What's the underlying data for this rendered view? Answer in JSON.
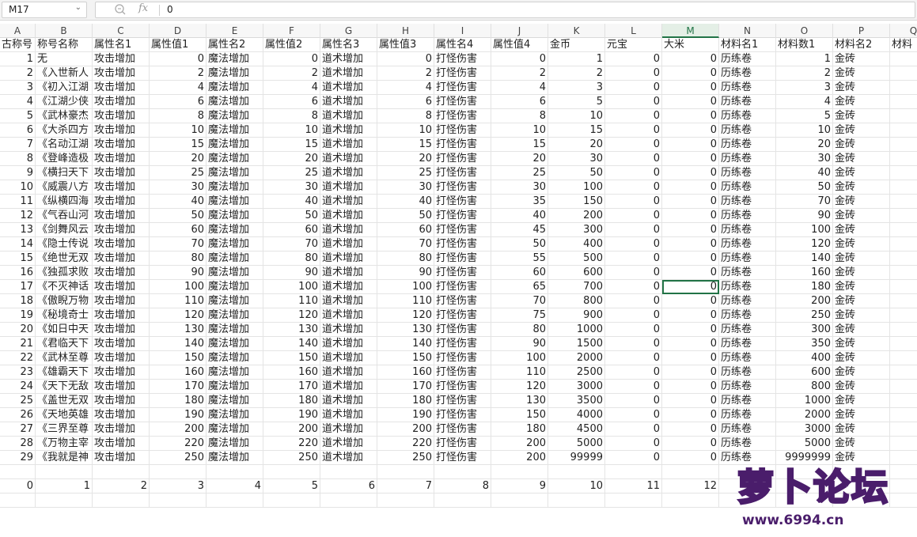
{
  "formula_bar": {
    "cell_ref": "M17",
    "fx_label": "fx",
    "formula": "0"
  },
  "columns": [
    "A",
    "B",
    "C",
    "D",
    "E",
    "F",
    "G",
    "H",
    "I",
    "J",
    "K",
    "L",
    "M",
    "N",
    "O",
    "P",
    "Q"
  ],
  "active_column": "M",
  "selected_cell": {
    "row": 16,
    "col": 12
  },
  "headers": [
    "古称号",
    "称号名称",
    "属性名1",
    "属性值1",
    "属性名2",
    "属性值2",
    "属性名3",
    "属性值3",
    "属性名4",
    "属性值4",
    "金币",
    "元宝",
    "大米",
    "材料名1",
    "材料数1",
    "材料名2",
    "材料"
  ],
  "rows": [
    [
      "1",
      "无",
      "攻击增加",
      "0",
      "魔法增加",
      "0",
      "道术增加",
      "0",
      "打怪伤害",
      "0",
      "1",
      "0",
      "0",
      "历练卷",
      "1",
      "金砖",
      ""
    ],
    [
      "2",
      "《入世新人",
      "攻击增加",
      "2",
      "魔法增加",
      "2",
      "道术增加",
      "2",
      "打怪伤害",
      "2",
      "2",
      "0",
      "0",
      "历练卷",
      "2",
      "金砖",
      ""
    ],
    [
      "3",
      "《初入江湖",
      "攻击增加",
      "4",
      "魔法增加",
      "4",
      "道术增加",
      "4",
      "打怪伤害",
      "4",
      "3",
      "0",
      "0",
      "历练卷",
      "3",
      "金砖",
      ""
    ],
    [
      "4",
      "《江湖少侠",
      "攻击增加",
      "6",
      "魔法增加",
      "6",
      "道术增加",
      "6",
      "打怪伤害",
      "6",
      "5",
      "0",
      "0",
      "历练卷",
      "4",
      "金砖",
      ""
    ],
    [
      "5",
      "《武林豪杰",
      "攻击增加",
      "8",
      "魔法增加",
      "8",
      "道术增加",
      "8",
      "打怪伤害",
      "8",
      "10",
      "0",
      "0",
      "历练卷",
      "5",
      "金砖",
      ""
    ],
    [
      "6",
      "《大杀四方",
      "攻击增加",
      "10",
      "魔法增加",
      "10",
      "道术增加",
      "10",
      "打怪伤害",
      "10",
      "15",
      "0",
      "0",
      "历练卷",
      "10",
      "金砖",
      ""
    ],
    [
      "7",
      "《名动江湖",
      "攻击增加",
      "15",
      "魔法增加",
      "15",
      "道术增加",
      "15",
      "打怪伤害",
      "15",
      "20",
      "0",
      "0",
      "历练卷",
      "20",
      "金砖",
      ""
    ],
    [
      "8",
      "《登峰造极",
      "攻击增加",
      "20",
      "魔法增加",
      "20",
      "道术增加",
      "20",
      "打怪伤害",
      "20",
      "30",
      "0",
      "0",
      "历练卷",
      "30",
      "金砖",
      ""
    ],
    [
      "9",
      "《横扫天下",
      "攻击增加",
      "25",
      "魔法增加",
      "25",
      "道术增加",
      "25",
      "打怪伤害",
      "25",
      "50",
      "0",
      "0",
      "历练卷",
      "40",
      "金砖",
      ""
    ],
    [
      "10",
      "《威震八方",
      "攻击增加",
      "30",
      "魔法增加",
      "30",
      "道术增加",
      "30",
      "打怪伤害",
      "30",
      "100",
      "0",
      "0",
      "历练卷",
      "50",
      "金砖",
      ""
    ],
    [
      "11",
      "《纵横四海",
      "攻击增加",
      "40",
      "魔法增加",
      "40",
      "道术增加",
      "40",
      "打怪伤害",
      "35",
      "150",
      "0",
      "0",
      "历练卷",
      "70",
      "金砖",
      ""
    ],
    [
      "12",
      "《气吞山河",
      "攻击增加",
      "50",
      "魔法增加",
      "50",
      "道术增加",
      "50",
      "打怪伤害",
      "40",
      "200",
      "0",
      "0",
      "历练卷",
      "90",
      "金砖",
      ""
    ],
    [
      "13",
      "《剑舞风云",
      "攻击增加",
      "60",
      "魔法增加",
      "60",
      "道术增加",
      "60",
      "打怪伤害",
      "45",
      "300",
      "0",
      "0",
      "历练卷",
      "100",
      "金砖",
      ""
    ],
    [
      "14",
      "《隐士传说",
      "攻击增加",
      "70",
      "魔法增加",
      "70",
      "道术增加",
      "70",
      "打怪伤害",
      "50",
      "400",
      "0",
      "0",
      "历练卷",
      "120",
      "金砖",
      ""
    ],
    [
      "15",
      "《绝世无双",
      "攻击增加",
      "80",
      "魔法增加",
      "80",
      "道术增加",
      "80",
      "打怪伤害",
      "55",
      "500",
      "0",
      "0",
      "历练卷",
      "140",
      "金砖",
      ""
    ],
    [
      "16",
      "《独孤求败",
      "攻击增加",
      "90",
      "魔法增加",
      "90",
      "道术增加",
      "90",
      "打怪伤害",
      "60",
      "600",
      "0",
      "0",
      "历练卷",
      "160",
      "金砖",
      ""
    ],
    [
      "17",
      "《不灭神话",
      "攻击增加",
      "100",
      "魔法增加",
      "100",
      "道术增加",
      "100",
      "打怪伤害",
      "65",
      "700",
      "0",
      "0",
      "历练卷",
      "180",
      "金砖",
      ""
    ],
    [
      "18",
      "《傲睨万物",
      "攻击增加",
      "110",
      "魔法增加",
      "110",
      "道术增加",
      "110",
      "打怪伤害",
      "70",
      "800",
      "0",
      "0",
      "历练卷",
      "200",
      "金砖",
      ""
    ],
    [
      "19",
      "《秘境奇士",
      "攻击增加",
      "120",
      "魔法增加",
      "120",
      "道术增加",
      "120",
      "打怪伤害",
      "75",
      "900",
      "0",
      "0",
      "历练卷",
      "250",
      "金砖",
      ""
    ],
    [
      "20",
      "《如日中天",
      "攻击增加",
      "130",
      "魔法增加",
      "130",
      "道术增加",
      "130",
      "打怪伤害",
      "80",
      "1000",
      "0",
      "0",
      "历练卷",
      "300",
      "金砖",
      ""
    ],
    [
      "21",
      "《君临天下",
      "攻击增加",
      "140",
      "魔法增加",
      "140",
      "道术增加",
      "140",
      "打怪伤害",
      "90",
      "1500",
      "0",
      "0",
      "历练卷",
      "350",
      "金砖",
      ""
    ],
    [
      "22",
      "《武林至尊",
      "攻击增加",
      "150",
      "魔法增加",
      "150",
      "道术增加",
      "150",
      "打怪伤害",
      "100",
      "2000",
      "0",
      "0",
      "历练卷",
      "400",
      "金砖",
      ""
    ],
    [
      "23",
      "《雄霸天下",
      "攻击增加",
      "160",
      "魔法增加",
      "160",
      "道术增加",
      "160",
      "打怪伤害",
      "110",
      "2500",
      "0",
      "0",
      "历练卷",
      "600",
      "金砖",
      ""
    ],
    [
      "24",
      "《天下无敌",
      "攻击增加",
      "170",
      "魔法增加",
      "170",
      "道术增加",
      "170",
      "打怪伤害",
      "120",
      "3000",
      "0",
      "0",
      "历练卷",
      "800",
      "金砖",
      ""
    ],
    [
      "25",
      "《盖世无双",
      "攻击增加",
      "180",
      "魔法增加",
      "180",
      "道术增加",
      "180",
      "打怪伤害",
      "130",
      "3500",
      "0",
      "0",
      "历练卷",
      "1000",
      "金砖",
      ""
    ],
    [
      "26",
      "《天地英雄",
      "攻击增加",
      "190",
      "魔法增加",
      "190",
      "道术增加",
      "190",
      "打怪伤害",
      "150",
      "4000",
      "0",
      "0",
      "历练卷",
      "2000",
      "金砖",
      ""
    ],
    [
      "27",
      "《三界至尊",
      "攻击增加",
      "200",
      "魔法增加",
      "200",
      "道术增加",
      "200",
      "打怪伤害",
      "180",
      "4500",
      "0",
      "0",
      "历练卷",
      "3000",
      "金砖",
      ""
    ],
    [
      "28",
      "《万物主宰",
      "攻击增加",
      "220",
      "魔法增加",
      "220",
      "道术增加",
      "220",
      "打怪伤害",
      "200",
      "5000",
      "0",
      "0",
      "历练卷",
      "5000",
      "金砖",
      ""
    ],
    [
      "29",
      "《我就是神",
      "攻击增加",
      "250",
      "魔法增加",
      "250",
      "道术增加",
      "250",
      "打怪伤害",
      "200",
      "99999",
      "0",
      "0",
      "历练卷",
      "9999999",
      "金砖",
      ""
    ]
  ],
  "blank_row": [
    "",
    "",
    "",
    "",
    "",
    "",
    "",
    "",
    "",
    "",
    "",
    "",
    "",
    "",
    "",
    "",
    ""
  ],
  "index_row": [
    "0",
    "1",
    "2",
    "3",
    "4",
    "5",
    "6",
    "7",
    "8",
    "9",
    "10",
    "11",
    "12",
    "",
    "",
    "",
    ""
  ],
  "logo": {
    "name": "萝卜论坛",
    "url": "www.6994.cn",
    "color_fill": "#f4a300",
    "color_outline": "#4a1d6b"
  }
}
